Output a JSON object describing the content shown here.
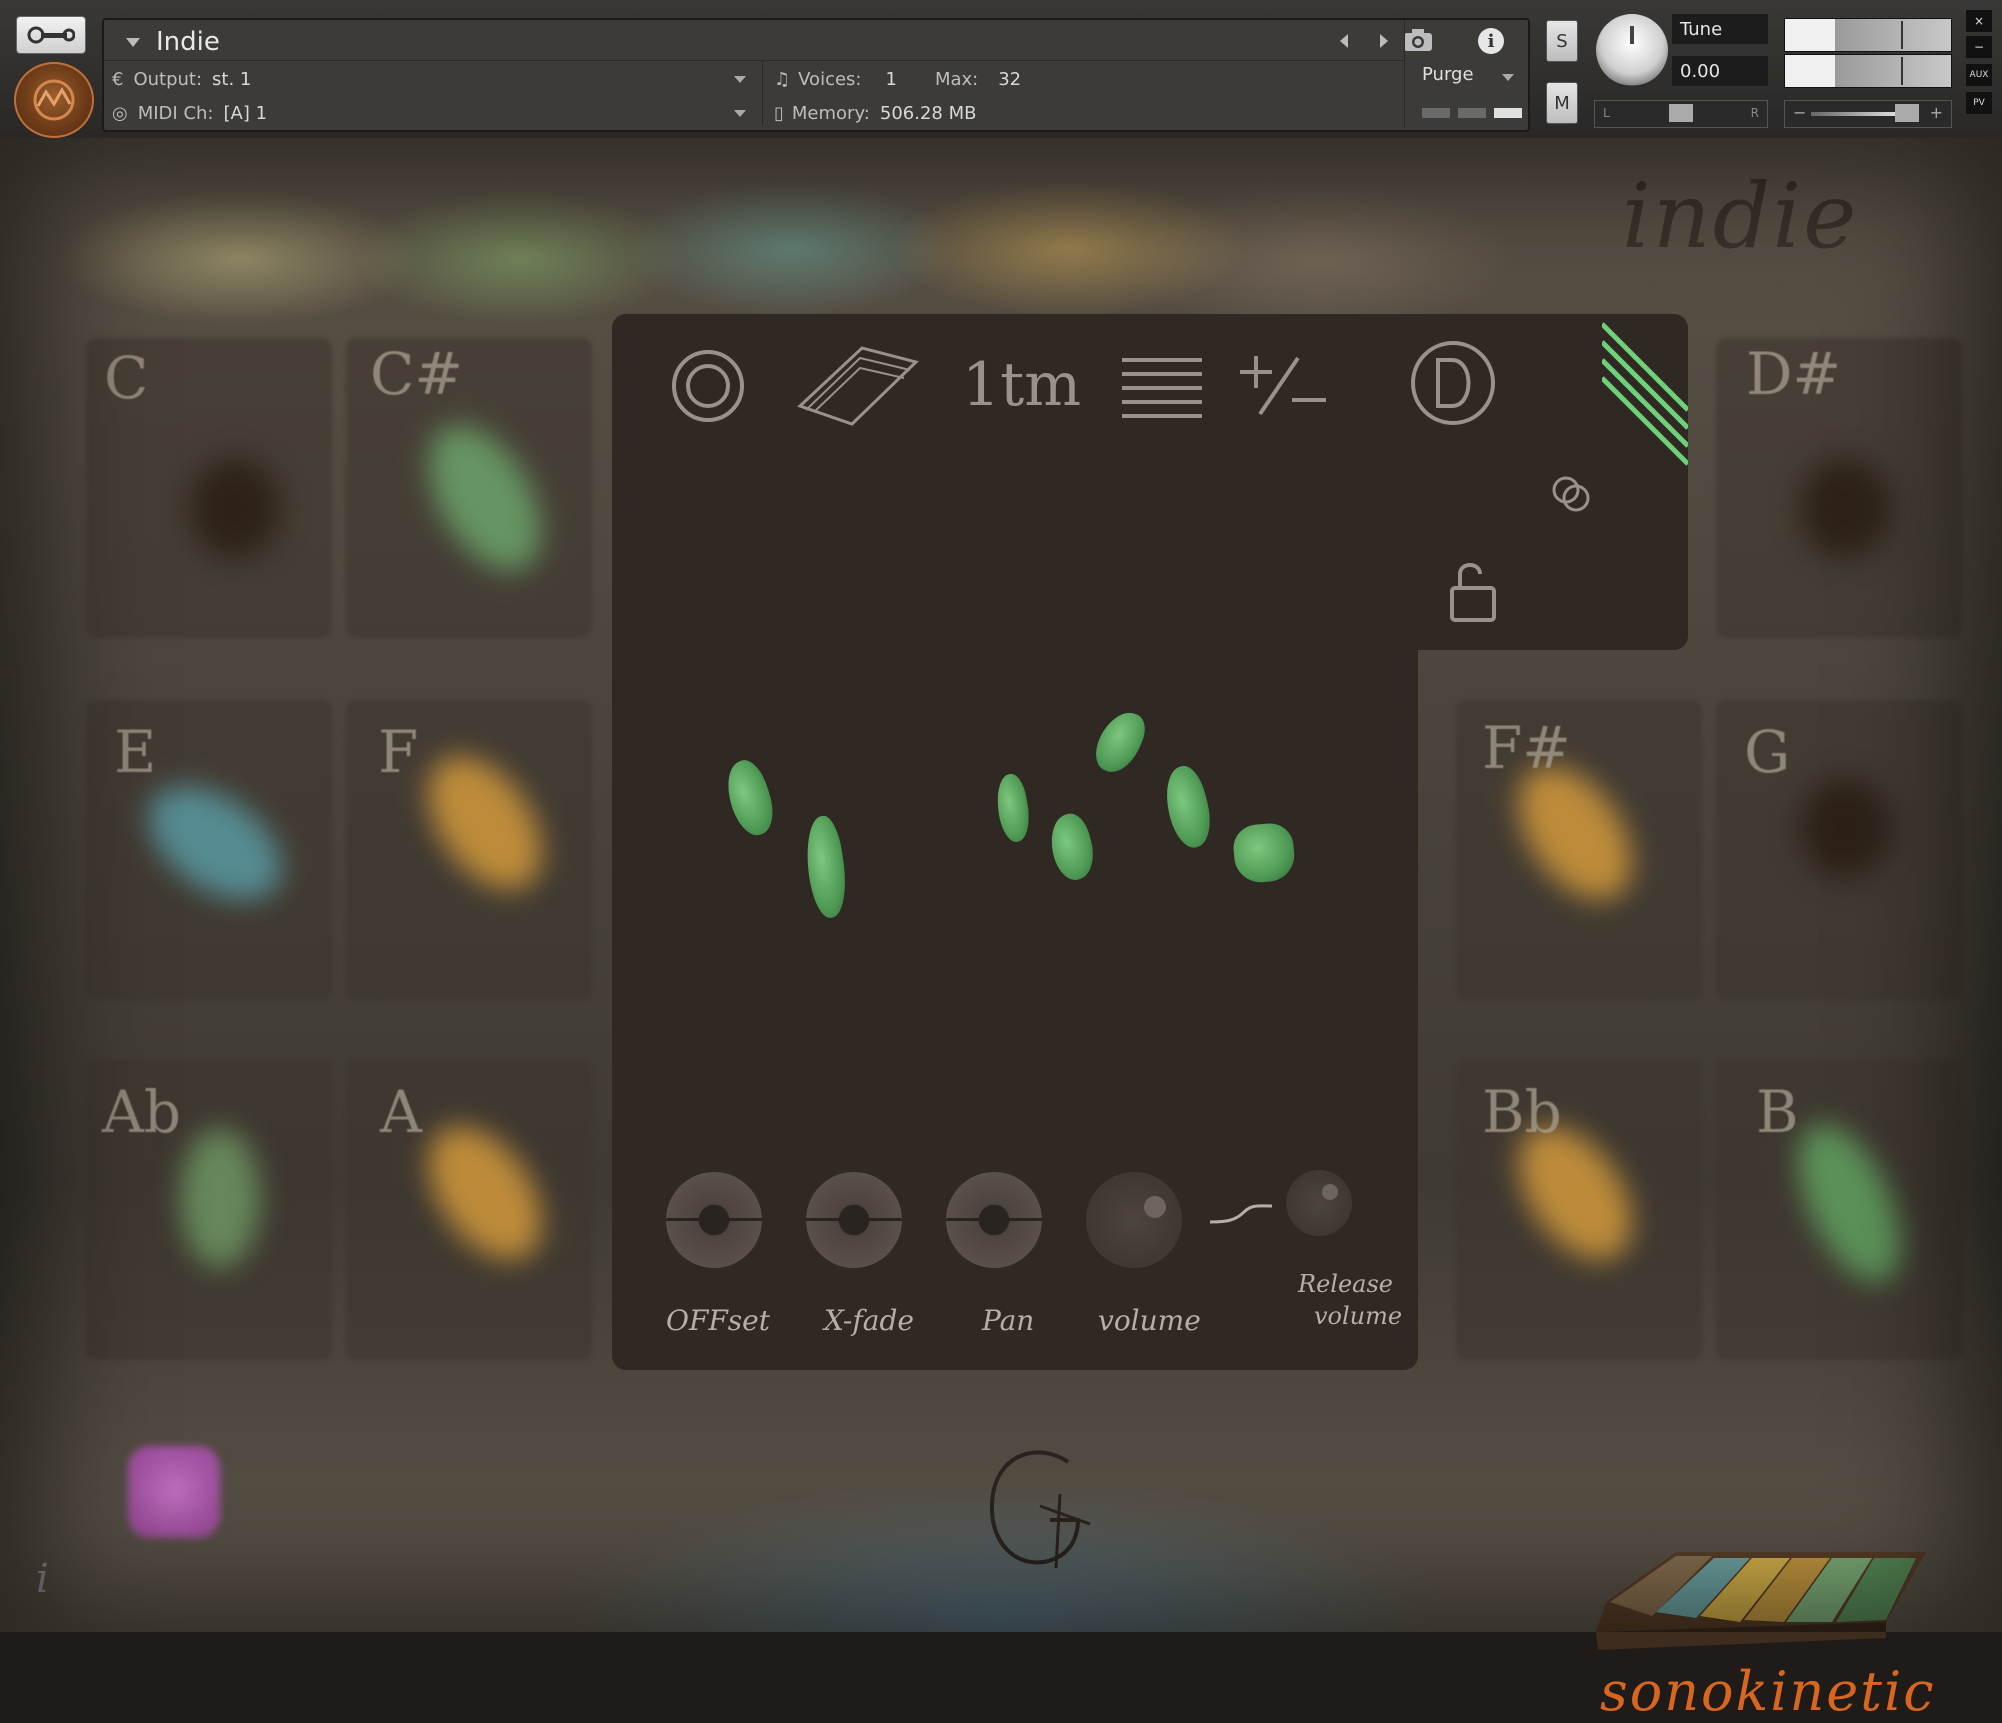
{
  "header": {
    "instrument_name": "Indie",
    "output_label": "Output:",
    "output_value": "st. 1",
    "midi_label": "MIDI Ch:",
    "midi_value": "[A]  1",
    "voices_label": "Voices:",
    "voices_value": "1",
    "max_label": "Max:",
    "max_value": "32",
    "memory_label": "Memory:",
    "memory_value": "506.28 MB",
    "purge_label": "Purge",
    "info_glyph": "i",
    "solo_label": "S",
    "mute_label": "M",
    "tune_label": "Tune",
    "tune_value": "0.00",
    "pan_left": "L",
    "pan_right": "R",
    "vol_minus": "−",
    "vol_plus": "+",
    "close_glyph": "×",
    "minimize_glyph": "−",
    "aux_label": "AUX",
    "pv_label": "PV"
  },
  "brand": {
    "title": "indie",
    "maker": "sonokinetic"
  },
  "notes": [
    "C",
    "C#",
    "D#",
    "E",
    "F",
    "F#",
    "G",
    "Ab",
    "A",
    "Bb",
    "B"
  ],
  "panel": {
    "tabs": [
      "ring-icon",
      "book-icon",
      "tempo-icon",
      "lines-icon",
      "plus-minus-icon",
      "d-icon"
    ],
    "tempo_label": "1tm",
    "knobs": [
      {
        "label": "OFFset"
      },
      {
        "label": "X-fade"
      },
      {
        "label": "Pan"
      },
      {
        "label": "volume"
      }
    ],
    "release_label_1": "Release",
    "release_label_2": "volume"
  },
  "colors": {
    "accent_green": "#5fae62",
    "brand_orange": "#d9661f",
    "panel_bg": "#2f2823"
  }
}
